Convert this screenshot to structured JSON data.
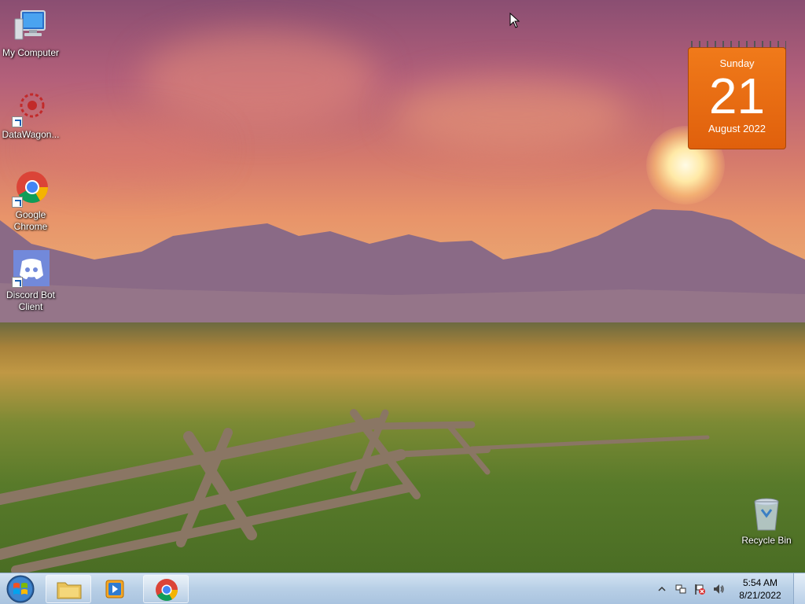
{
  "desktop": {
    "icons": [
      {
        "label": "My Computer",
        "icon": "computer-icon"
      },
      {
        "label": "DataWagon...",
        "icon": "datawagon-icon"
      },
      {
        "label": "Google Chrome",
        "icon": "chrome-icon"
      },
      {
        "label": "Discord Bot Client",
        "icon": "discord-icon"
      },
      {
        "label": "Recycle Bin",
        "icon": "recycle-bin-icon"
      }
    ]
  },
  "calendar": {
    "weekday": "Sunday",
    "day": "21",
    "month_year": "August 2022"
  },
  "taskbar": {
    "start": "start-orb-icon",
    "buttons": [
      {
        "name": "file-explorer",
        "icon": "folder-icon"
      },
      {
        "name": "media-player",
        "icon": "media-player-icon"
      },
      {
        "name": "chrome",
        "icon": "chrome-icon"
      }
    ],
    "tray": {
      "time": "5:54 AM",
      "date": "8/21/2022"
    }
  },
  "colors": {
    "calendar_orange": "#e8680f",
    "taskbar_blue": "#b8cfe6"
  }
}
